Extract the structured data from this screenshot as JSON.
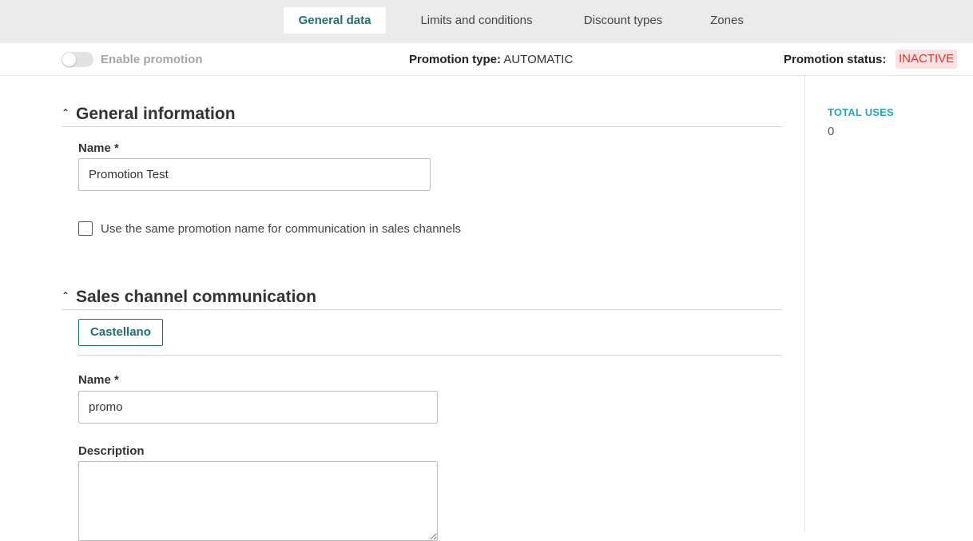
{
  "tabs": [
    {
      "label": "General data",
      "active": true
    },
    {
      "label": "Limits and conditions",
      "active": false
    },
    {
      "label": "Discount types",
      "active": false
    },
    {
      "label": "Zones",
      "active": false
    }
  ],
  "status_bar": {
    "enable_label": "Enable promotion",
    "enabled": false,
    "promotion_type_label": "Promotion type:",
    "promotion_type_value": "AUTOMATIC",
    "promotion_status_label": "Promotion status:",
    "promotion_status_value": "INACTIVE"
  },
  "sidebar": {
    "total_uses_label": "TOTAL USES",
    "total_uses_value": "0"
  },
  "general_information": {
    "title": "General information",
    "name_label": "Name *",
    "name_value": "Promotion Test",
    "same_name_checkbox_label": "Use the same promotion name for communication in sales channels",
    "same_name_checked": false
  },
  "sales_channel": {
    "title": "Sales channel communication",
    "language_tab": "Castellano",
    "name_label": "Name *",
    "name_value": "promo",
    "description_label": "Description",
    "description_value": ""
  },
  "colors": {
    "accent": "#1e6f6f",
    "status_inactive": "#e0322f",
    "status_inactive_bg": "#fde2e2",
    "total_uses": "#2ea3b8"
  }
}
